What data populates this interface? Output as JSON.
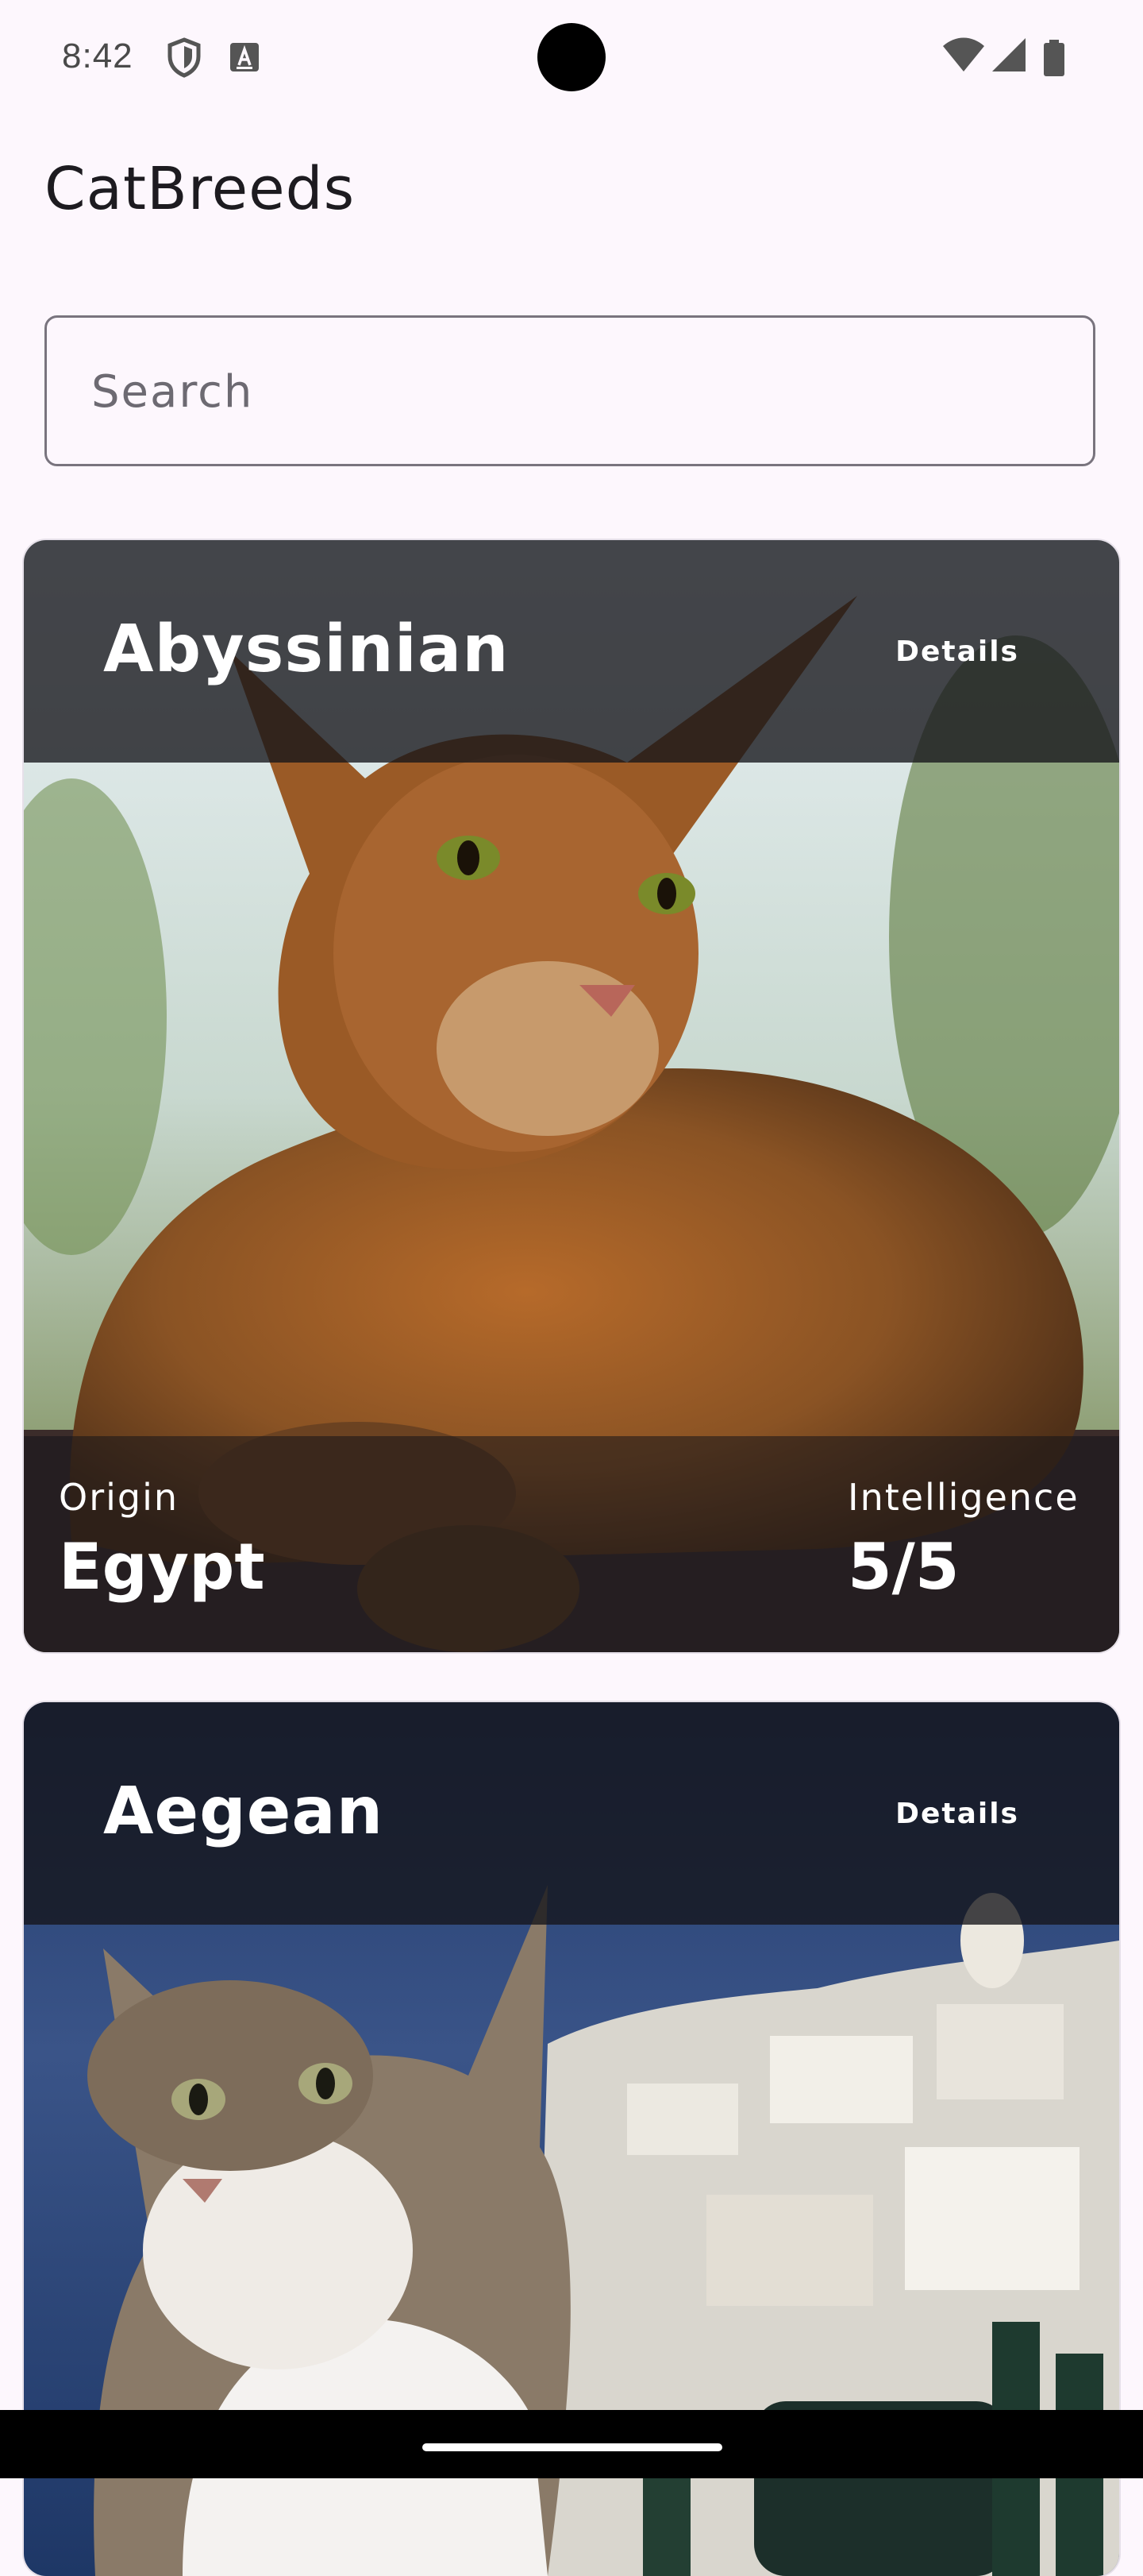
{
  "status_bar": {
    "time": "8:42",
    "left_icons": [
      "shield-icon",
      "keyboard-a-icon"
    ],
    "right_icons": [
      "wifi-icon",
      "cellular-signal-icon",
      "battery-icon"
    ]
  },
  "app": {
    "title": "CatBreeds"
  },
  "search": {
    "placeholder": "Search",
    "value": ""
  },
  "breeds": [
    {
      "name": "Abyssinian",
      "details_label": "Details",
      "origin_label": "Origin",
      "origin": "Egypt",
      "intelligence_label": "Intelligence",
      "intelligence": "5/5",
      "image": "abyssinian-cat-photo"
    },
    {
      "name": "Aegean",
      "details_label": "Details",
      "image": "aegean-cat-photo"
    }
  ],
  "colors": {
    "background": "#fdf7fd",
    "outline": "#79747e",
    "overlay": "#14141a",
    "text_on_image": "#ffffff"
  }
}
